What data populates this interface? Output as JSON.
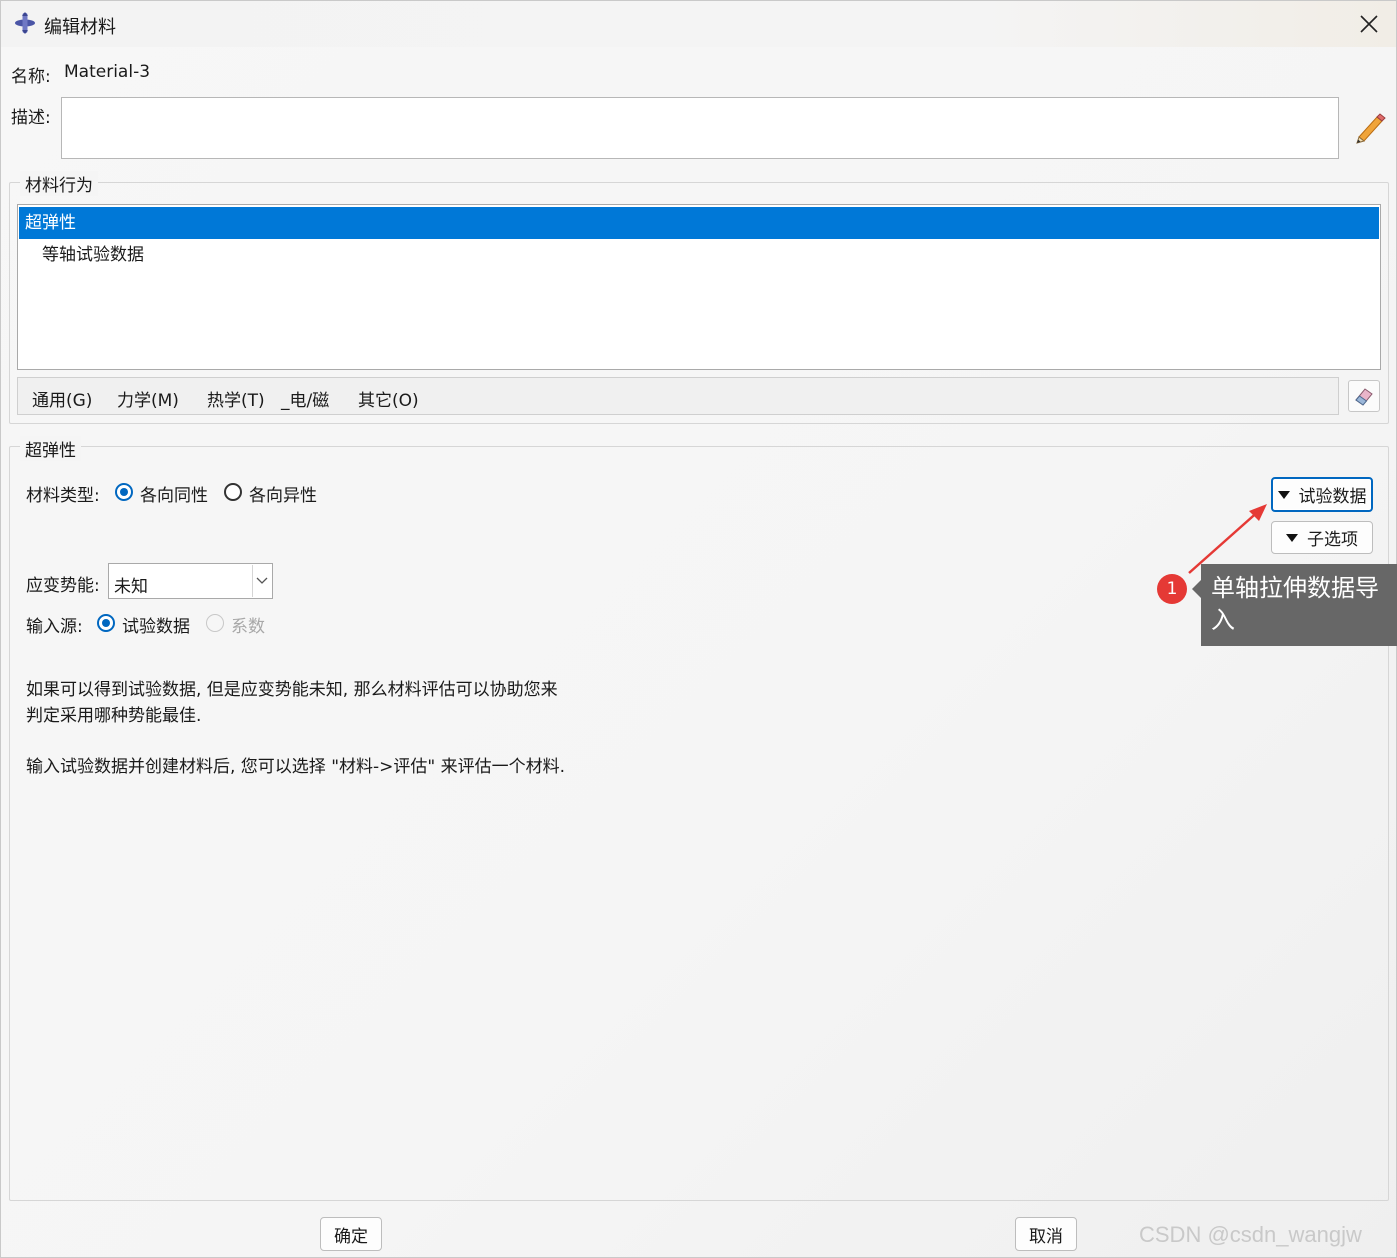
{
  "window": {
    "title": "编辑材料",
    "close_symbol": "✕"
  },
  "name": {
    "label": "名称:",
    "value": "Material-3"
  },
  "description": {
    "label": "描述:",
    "value": ""
  },
  "material_behaviors": {
    "group_title": "材料行为",
    "items": [
      {
        "label": "超弹性",
        "selected": true
      },
      {
        "label": "等轴试验数据",
        "selected": false
      }
    ]
  },
  "menubar": {
    "items": [
      "通用(G)",
      "力学(M)",
      "热学(T)",
      "_电/磁",
      "其它(O)"
    ]
  },
  "hyperelastic": {
    "group_title": "超弹性",
    "material_type": {
      "label": "材料类型:",
      "options": [
        "各向同性",
        "各向异性"
      ],
      "selected": "各向同性"
    },
    "strain_energy": {
      "label": "应变势能:",
      "value": "未知"
    },
    "input_source": {
      "label": "输入源:",
      "options": [
        "试验数据",
        "系数"
      ],
      "selected": "试验数据"
    },
    "test_data_button": "试验数据",
    "suboptions_button": "子选项",
    "info_line1": "如果可以得到试验数据, 但是应变势能未知, 那么材料评估可以协助您来",
    "info_line2": "判定采用哪种势能最佳.",
    "info_line3": "输入试验数据并创建材料后, 您可以选择 \"材料->评估\" 来评估一个材料."
  },
  "annotation": {
    "badge": "1",
    "tooltip_line1": "单轴拉伸数据导",
    "tooltip_line2": "入",
    "color": "#e53935"
  },
  "footer": {
    "ok_label": "确定",
    "cancel_label": "取消"
  },
  "watermark": "CSDN @csdn_wangjw",
  "colors": {
    "selection": "#0078d7",
    "radio_checked": "#0067c0"
  }
}
